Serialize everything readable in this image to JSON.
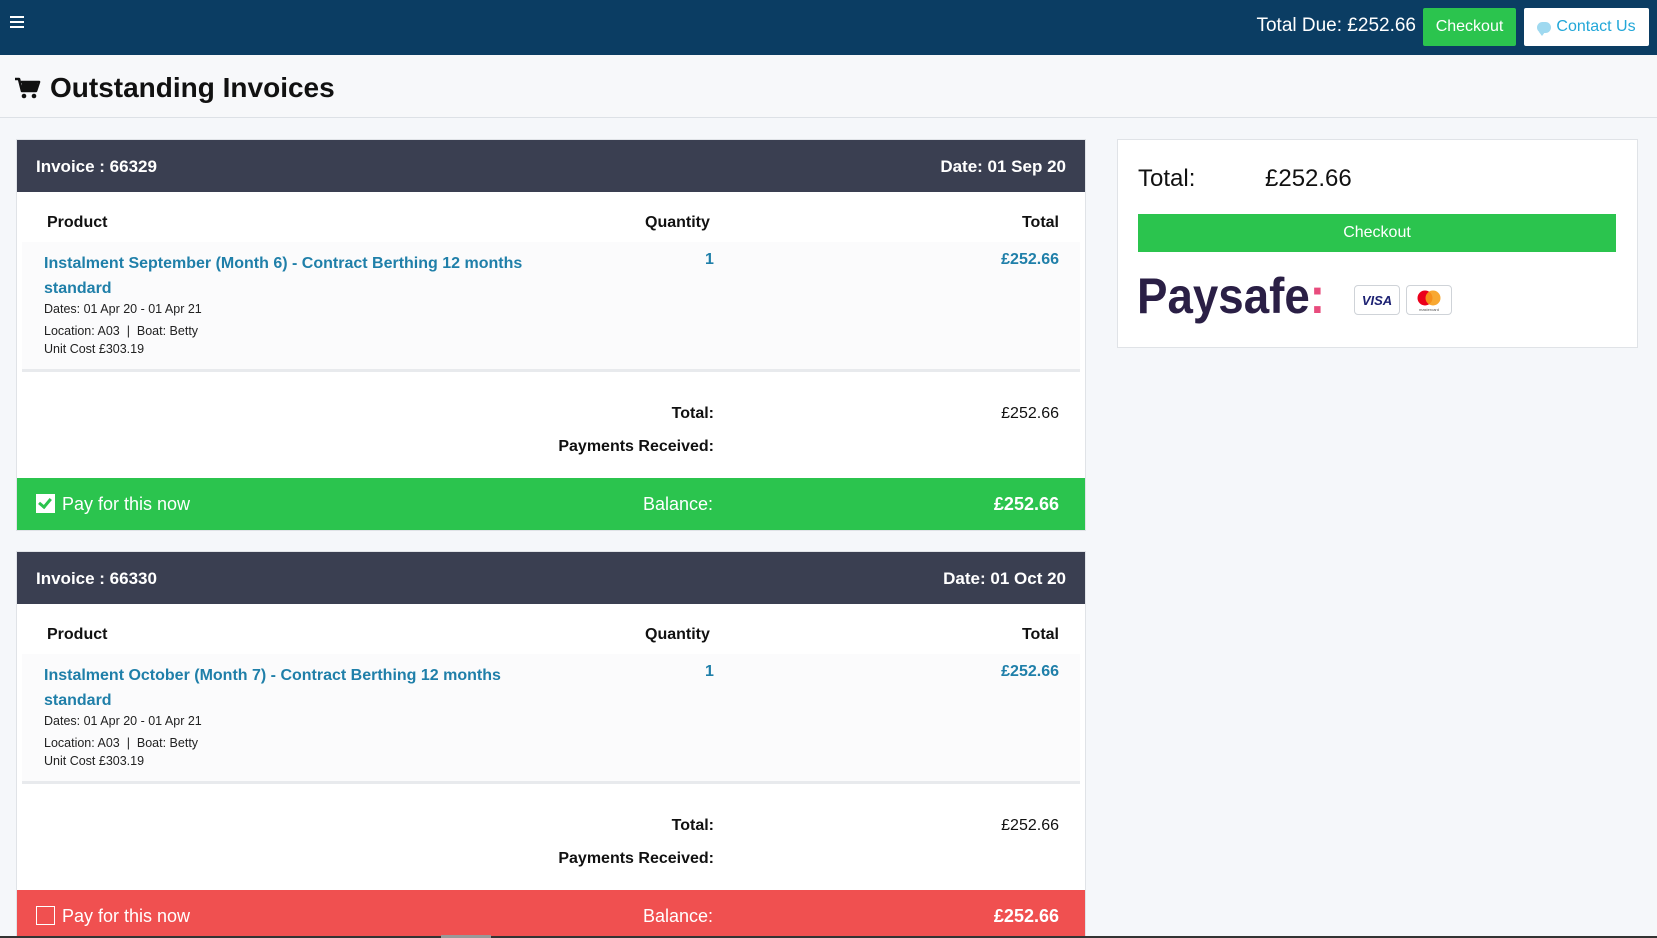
{
  "topbar": {
    "menu_icon": "hamburger-icon",
    "total_due": "Total Due: £252.66",
    "checkout_label": "Checkout",
    "contact_label": "Contact Us"
  },
  "page": {
    "title": "Outstanding Invoices",
    "icon": "cart-icon"
  },
  "columns": {
    "product": "Product",
    "quantity": "Quantity",
    "total": "Total"
  },
  "invoices": [
    {
      "number": "Invoice : 66329",
      "date": "Date: 01 Sep 20",
      "product": "Instalment September (Month 6) - Contract Berthing 12 months standard",
      "dates": "Dates: 01 Apr 20 - 01 Apr 21",
      "location": "Location: A03  |  Boat: Betty",
      "unit_cost": "Unit Cost £303.19",
      "quantity": "1",
      "line_total": "£252.66",
      "total_label": "Total:",
      "total_value": "£252.66",
      "payments_label": "Payments Received:",
      "pay_label": "Pay for this now",
      "pay_checked": true,
      "balance_label": "Balance:",
      "balance_value": "£252.66",
      "balance_color": "#2bc44e"
    },
    {
      "number": "Invoice : 66330",
      "date": "Date: 01 Oct 20",
      "product": "Instalment October (Month 7) - Contract Berthing 12 months standard",
      "dates": "Dates: 01 Apr 20 - 01 Apr 21",
      "location": "Location: A03  |  Boat: Betty",
      "unit_cost": "Unit Cost £303.19",
      "quantity": "1",
      "line_total": "£252.66",
      "total_label": "Total:",
      "total_value": "£252.66",
      "payments_label": "Payments Received:",
      "pay_label": "Pay for this now",
      "pay_checked": false,
      "balance_label": "Balance:",
      "balance_value": "£252.66",
      "balance_color": "#f05050"
    }
  ],
  "summary": {
    "total_label": "Total:",
    "total_value": "£252.66",
    "checkout_label": "Checkout",
    "provider_logo": "Paysafe:",
    "card_visa": "VISA",
    "card_mastercard": "mastercard"
  },
  "colors": {
    "topbar": "#0b3d63",
    "accent_green": "#2bc44e",
    "accent_red": "#f05050",
    "invoice_header": "#3a3f51",
    "link_blue": "#1f7fa9"
  }
}
